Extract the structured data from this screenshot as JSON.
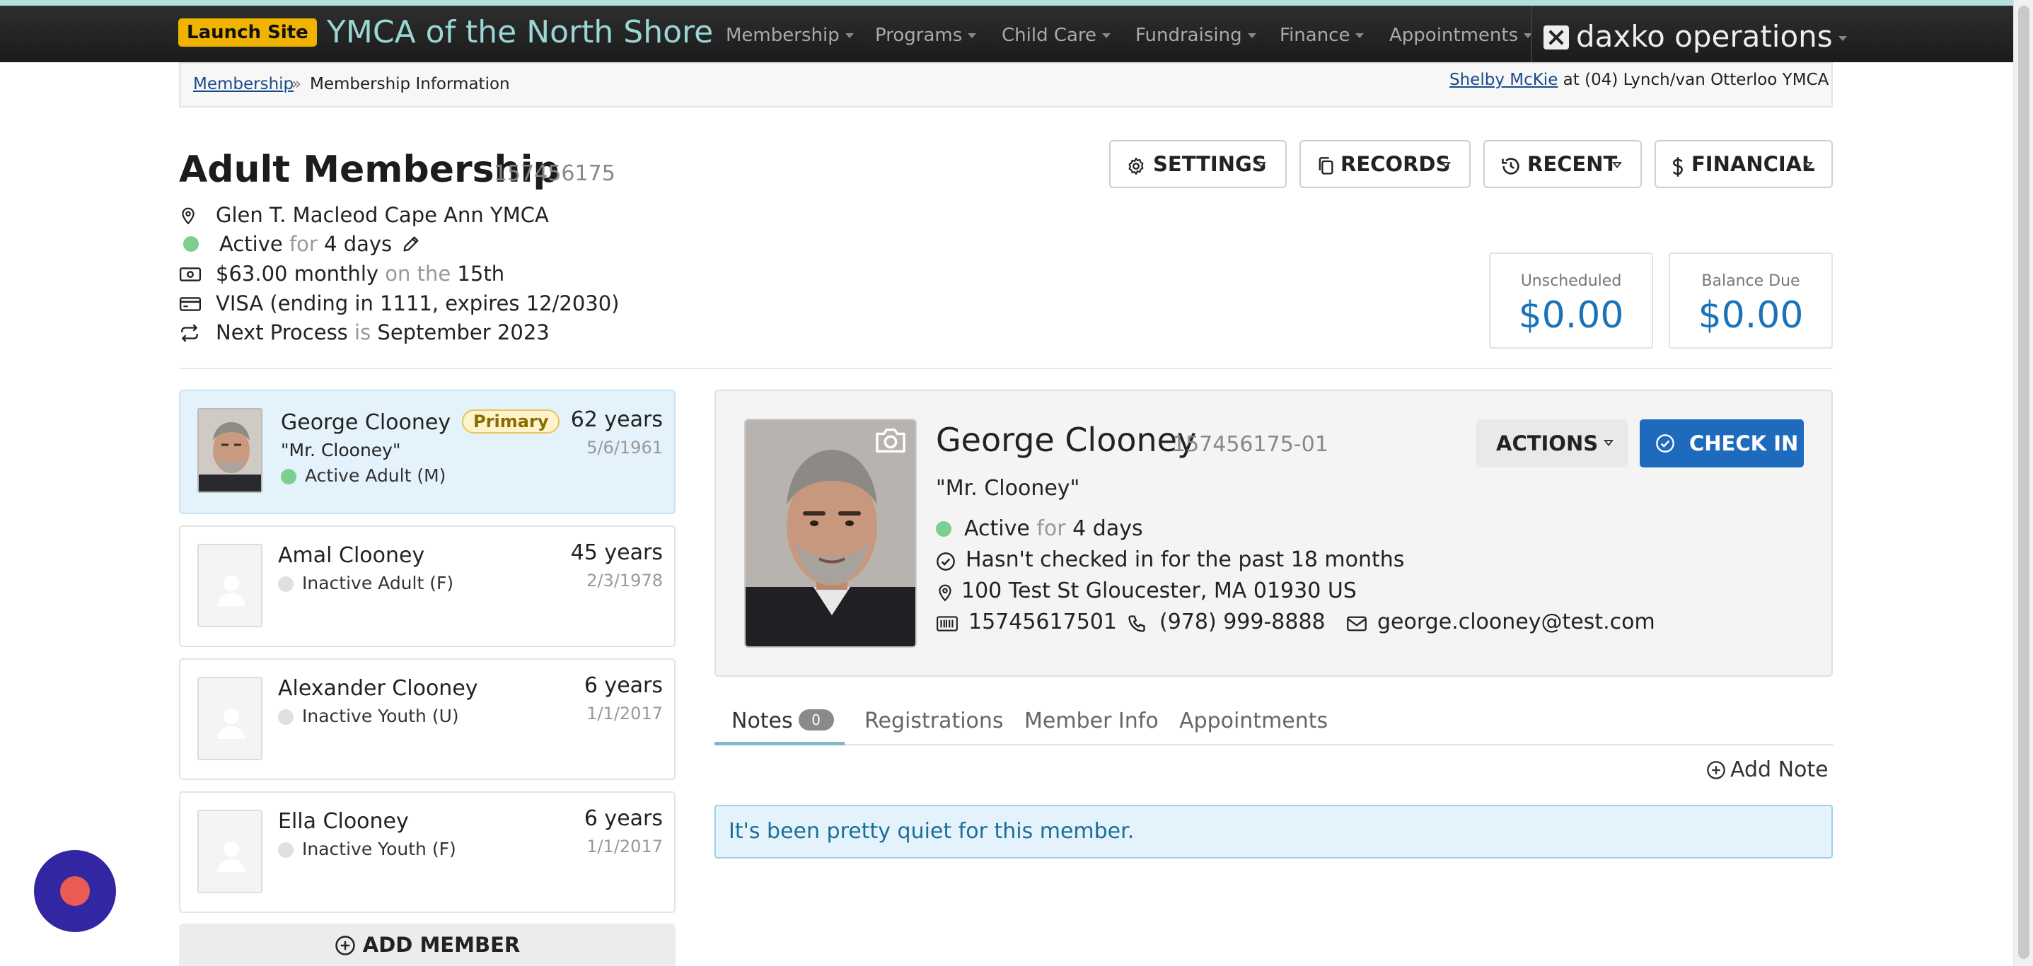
{
  "nav": {
    "launch_label": "Launch Site",
    "org_name": "YMCA of the North Shore",
    "items": [
      "Membership",
      "Programs",
      "Child Care",
      "Fundraising",
      "Finance",
      "Appointments"
    ],
    "brand": "daxko operations"
  },
  "breadcrumb": {
    "link": "Membership",
    "separator": "»",
    "current": "Membership Information"
  },
  "user": {
    "name": "Shelby McKie",
    "at_text": "at (04) Lynch/van Otterloo YMCA"
  },
  "membership": {
    "title": "Adult Membership",
    "id": "157456175",
    "branch": "Glen T. Macleod Cape Ann YMCA",
    "status": "Active",
    "for_word": "for",
    "duration": "4 days",
    "price": "$63.00 monthly",
    "on_the": "on the",
    "bill_day": "15th",
    "card": "VISA (ending in 1111, expires 12/2030)",
    "next_label": "Next Process",
    "is_word": "is",
    "next_value": "September 2023"
  },
  "toolbar": {
    "settings": "SETTINGS",
    "records": "RECORDS",
    "recent": "RECENT",
    "financial": "FINANCIAL"
  },
  "balances": {
    "unscheduled_label": "Unscheduled",
    "unscheduled_value": "$0.00",
    "due_label": "Balance Due",
    "due_value": "$0.00"
  },
  "members": [
    {
      "name": "George Clooney",
      "badge": "Primary",
      "nickname": "\"Mr. Clooney\"",
      "status": "Active Adult (M)",
      "age": "62 years",
      "dob": "5/6/1961"
    },
    {
      "name": "Amal Clooney",
      "status": "Inactive Adult (F)",
      "age": "45 years",
      "dob": "2/3/1978"
    },
    {
      "name": "Alexander Clooney",
      "status": "Inactive Youth (U)",
      "age": "6 years",
      "dob": "1/1/2017"
    },
    {
      "name": "Ella Clooney",
      "status": "Inactive Youth (F)",
      "age": "6 years",
      "dob": "1/1/2017"
    }
  ],
  "add_member_label": "ADD MEMBER",
  "profile": {
    "name": "George Clooney",
    "id": "157456175-01",
    "nickname": "\"Mr. Clooney\"",
    "status": "Active",
    "for_word": "for",
    "duration": "4 days",
    "checkin_note": "Hasn't checked in for the past 18 months",
    "address": "100 Test St Gloucester, MA 01930 US",
    "barcode": "15745617501",
    "phone": "(978) 999-8888",
    "email": "george.clooney@test.com",
    "actions_label": "ACTIONS",
    "checkin_label": "CHECK IN"
  },
  "tabs": [
    {
      "label": "Notes",
      "badge": "0"
    },
    {
      "label": "Registrations"
    },
    {
      "label": "Member Info"
    },
    {
      "label": "Appointments"
    }
  ],
  "add_note_label": "Add Note",
  "empty_message": "It's been pretty quiet for this member.",
  "colors": {
    "accent": "#1e6bbd",
    "launch": "#f0b400",
    "org": "#9ad6d3",
    "active_dot": "#7ccf8f",
    "fab": "#3326a3"
  }
}
